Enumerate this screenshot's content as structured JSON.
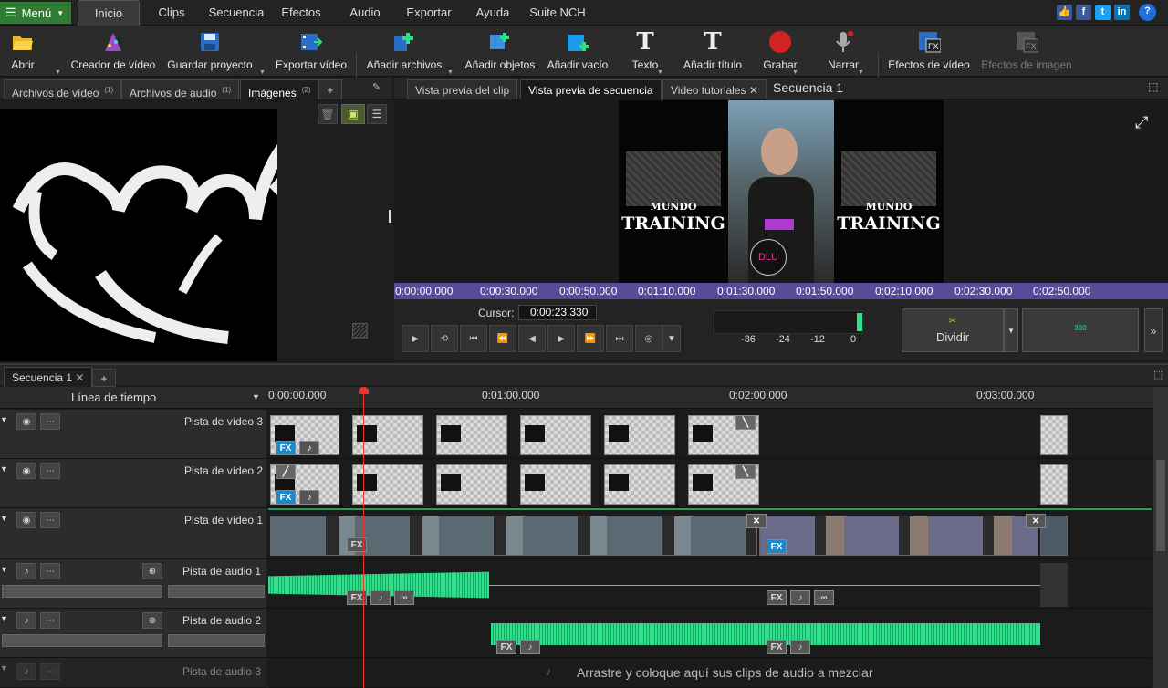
{
  "menubar": {
    "menu_label": "Menú",
    "tabs": [
      "Inicio",
      "Clips",
      "Secuencia",
      "Efectos",
      "Audio",
      "Exportar",
      "Ayuda",
      "Suite NCH"
    ]
  },
  "toolbar": {
    "buttons": [
      "Abrir",
      "Creador de vídeo",
      "Guardar proyecto",
      "Exportar vídeo",
      "Añadir archivos",
      "Añadir objetos",
      "Añadir vacío",
      "Texto",
      "Añadir título",
      "Grabar",
      "Narrar",
      "Efectos de vídeo",
      "Efectos de imagen"
    ]
  },
  "left_tabs": [
    {
      "label": "Archivos de vídeo",
      "count": "(1)"
    },
    {
      "label": "Archivos de audio",
      "count": "(1)"
    },
    {
      "label": "Imágenes",
      "count": "(2)"
    },
    {
      "label": "+"
    }
  ],
  "preview_tabs": {
    "clip": "Vista previa del clip",
    "sequence": "Vista previa de secuencia",
    "tutorials": "Video tutoriales",
    "title": "Secuencia 1"
  },
  "video_overlay": {
    "brand_top": "MUNDO",
    "brand_bottom": "TRAINING",
    "watermark": "DLU"
  },
  "scrubber_ticks": [
    "0:00:00.000",
    "0:00:30.000",
    "0:00:50.000",
    "0:01:10.000",
    "0:01:30.000",
    "0:01:50.000",
    "0:02:10.000",
    "0:02:30.000",
    "0:02:50.000"
  ],
  "transport": {
    "cursor_label": "Cursor:",
    "cursor_value": "0:00:23.330",
    "meter_ticks": [
      "-36",
      "-24",
      "-12",
      "0"
    ],
    "split_label": "Dividir",
    "extra_label": "360",
    "more": "»"
  },
  "sequence": {
    "tab": "Secuencia 1",
    "add": "+",
    "timeline_label": "Línea de tiempo",
    "ruler": [
      "0:00:00.000",
      "0:01:00.000",
      "0:02:00.000",
      "0:03:00.000"
    ]
  },
  "tracks": [
    "Pista de vídeo 3",
    "Pista de vídeo 2",
    "Pista de vídeo 1",
    "Pista de audio 1",
    "Pista de audio 2",
    "Pista de audio 3"
  ],
  "clip_labels": {
    "fx": "FX"
  },
  "drop_hint": "Arrastre y coloque aquí sus clips de audio a mezclar",
  "colors": {
    "menu_green": "#2e7d32",
    "wave_green": "#2ee08a",
    "scrubber": "#5a4a9a",
    "playhead": "#e33333"
  }
}
